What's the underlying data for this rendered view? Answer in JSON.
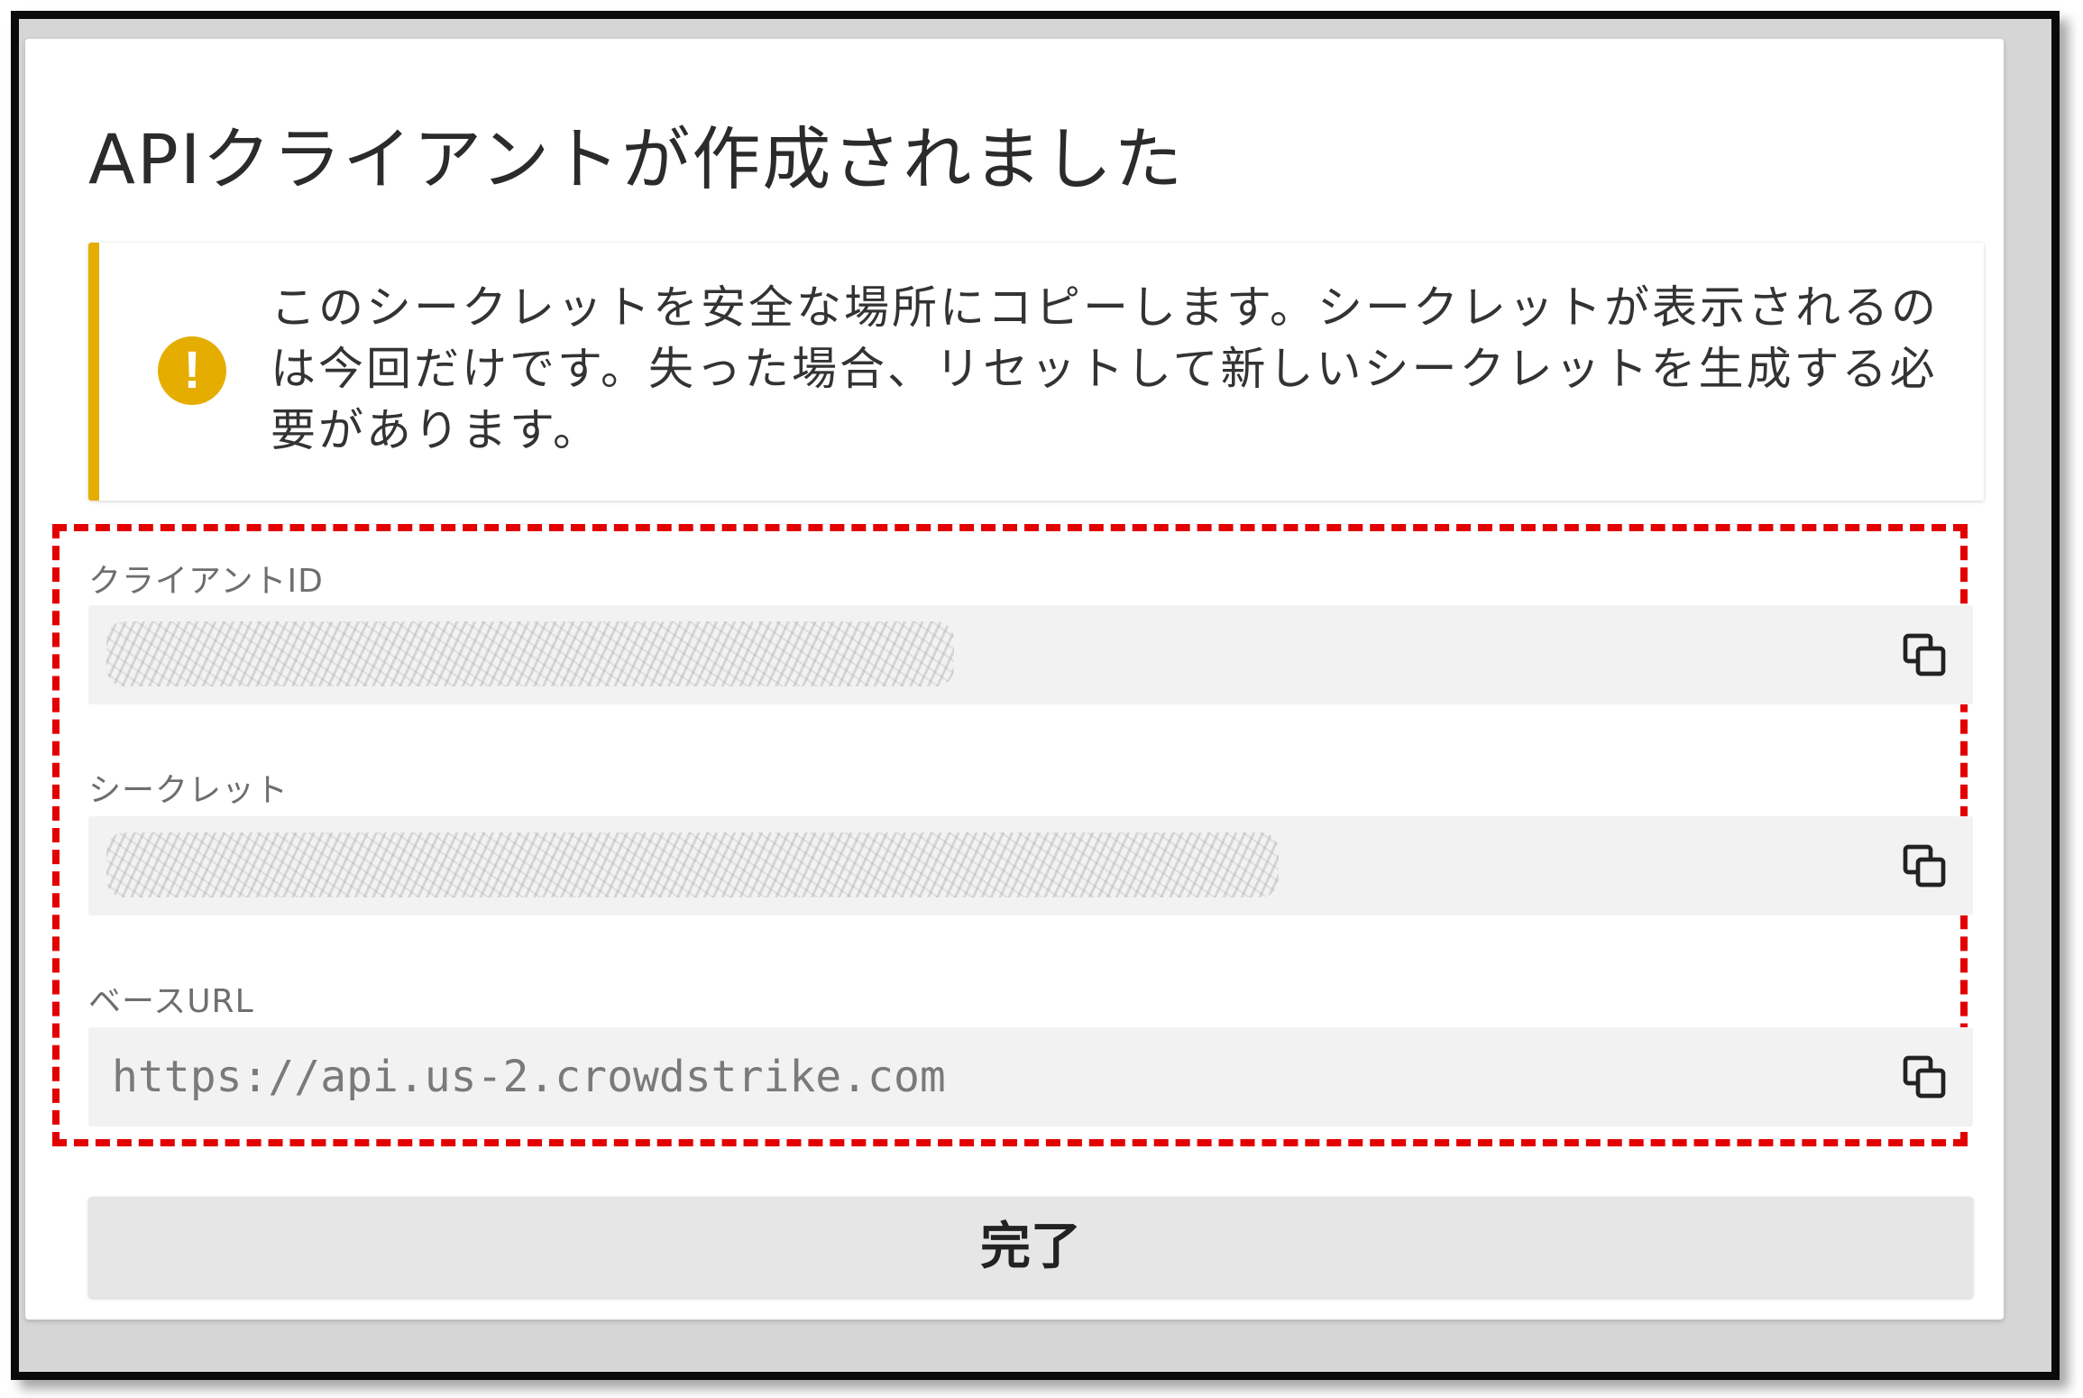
{
  "dialog": {
    "title": "APIクライアントが作成されました"
  },
  "alert": {
    "icon": "warning-icon",
    "icon_glyph": "!",
    "color": "#e5ad00",
    "message": "このシークレットを安全な場所にコピーします。シークレットが表示されるのは今回だけです。失った場合、リセットして新しいシークレットを生成する必要があります。"
  },
  "fields": [
    {
      "label": "クライアントID",
      "value": "",
      "masked": true,
      "copy_icon": "copy-icon"
    },
    {
      "label": "シークレット",
      "value": "",
      "masked": true,
      "copy_icon": "copy-icon"
    },
    {
      "label": "ベースURL",
      "value": "https://api.us-2.crowdstrike.com",
      "masked": false,
      "copy_icon": "copy-icon"
    }
  ],
  "highlight": {
    "color": "#e20000",
    "style": "dashed"
  },
  "done_button": {
    "label": "完了"
  }
}
